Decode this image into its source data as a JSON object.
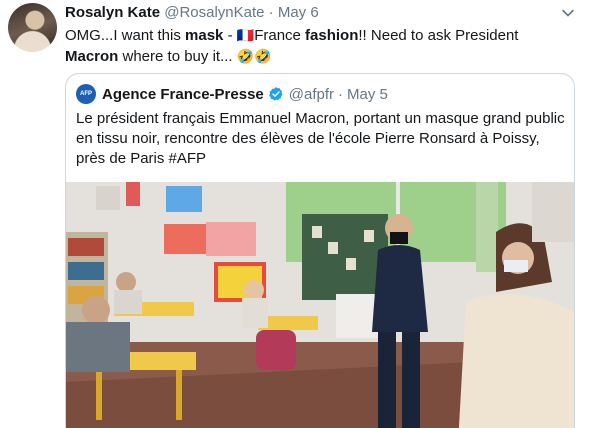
{
  "tweet": {
    "author_name": "Rosalyn Kate",
    "author_handle": "@RosalynKate",
    "separator": "·",
    "date": "May 6",
    "text_part1": "OMG...I want this ",
    "text_bold1": "mask",
    "text_part2": " - ",
    "flag_emoji": "🇫🇷",
    "text_part3": "France ",
    "text_bold2": "fashion",
    "text_part4": "!! Need to ask President ",
    "text_bold3": "Macron",
    "text_part5": " where to buy it... ",
    "laugh_emojis": "🤣🤣"
  },
  "quoted_tweet": {
    "avatar_text": "AFP",
    "author_name": "Agence France-Presse",
    "author_handle": "@afpfr",
    "separator": "·",
    "date": "May 5",
    "text": "Le président français Emmanuel Macron, portant un masque grand public en tissu noir, rencontre des élèves de l'école Pierre Ronsard à Poissy, près de Paris #AFP"
  },
  "icons": {
    "caret": "chevron-down-icon",
    "verified": "verified-badge-icon"
  },
  "colors": {
    "text_primary": "#14171a",
    "text_secondary": "#657786",
    "border": "#ccd6dd",
    "verified_blue": "#1da1f2",
    "afp_blue": "#1d5fb5"
  }
}
